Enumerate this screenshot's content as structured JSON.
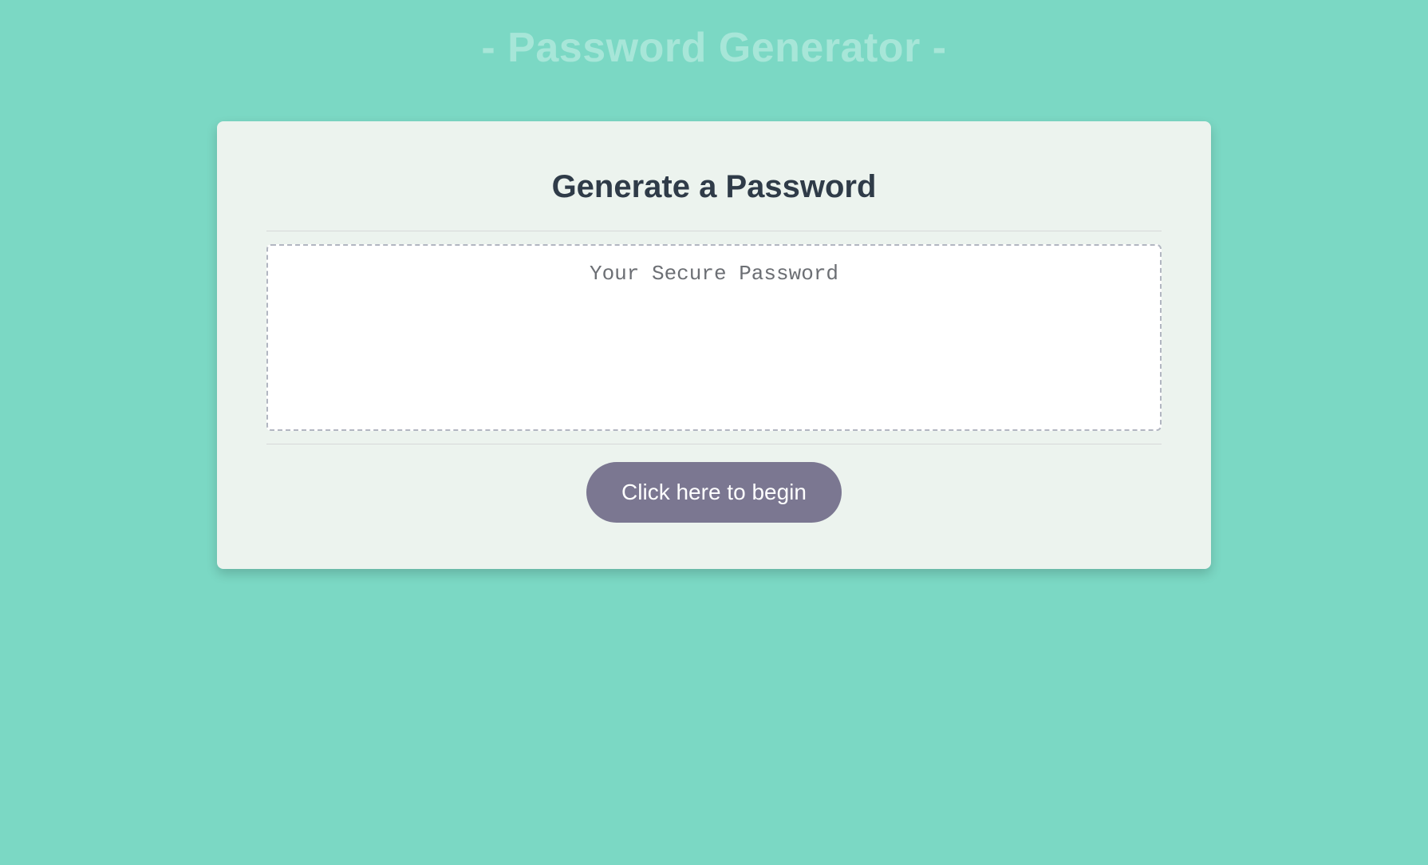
{
  "header": {
    "title": "- Password Generator -"
  },
  "card": {
    "heading": "Generate a Password",
    "output_placeholder": "Your Secure Password",
    "output_value": "",
    "button_label": "Click here to begin"
  },
  "colors": {
    "page_bg": "#7bd8c4",
    "title_text": "#a7e6d8",
    "card_bg": "#ecf3ee",
    "heading_text": "#2f3b48",
    "output_border": "#b2b6c1",
    "output_text": "#6c6f74",
    "button_bg": "#7b7791",
    "button_text": "#ffffff"
  }
}
